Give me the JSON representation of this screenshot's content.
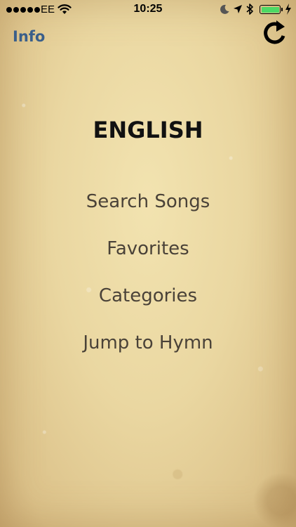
{
  "status_bar": {
    "carrier": "EE",
    "time": "10:25",
    "battery_level": 1.0,
    "battery_color": "#4cd964"
  },
  "nav": {
    "info_label": "Info",
    "refresh_icon": "refresh-icon"
  },
  "main": {
    "heading": "ENGLISH",
    "menu": [
      {
        "label": "Search Songs"
      },
      {
        "label": "Favorites"
      },
      {
        "label": "Categories"
      },
      {
        "label": "Jump to Hymn"
      }
    ]
  },
  "colors": {
    "accent": "#3a5f8a",
    "menu_text": "#4a4238",
    "background": "#e9d8a4"
  }
}
